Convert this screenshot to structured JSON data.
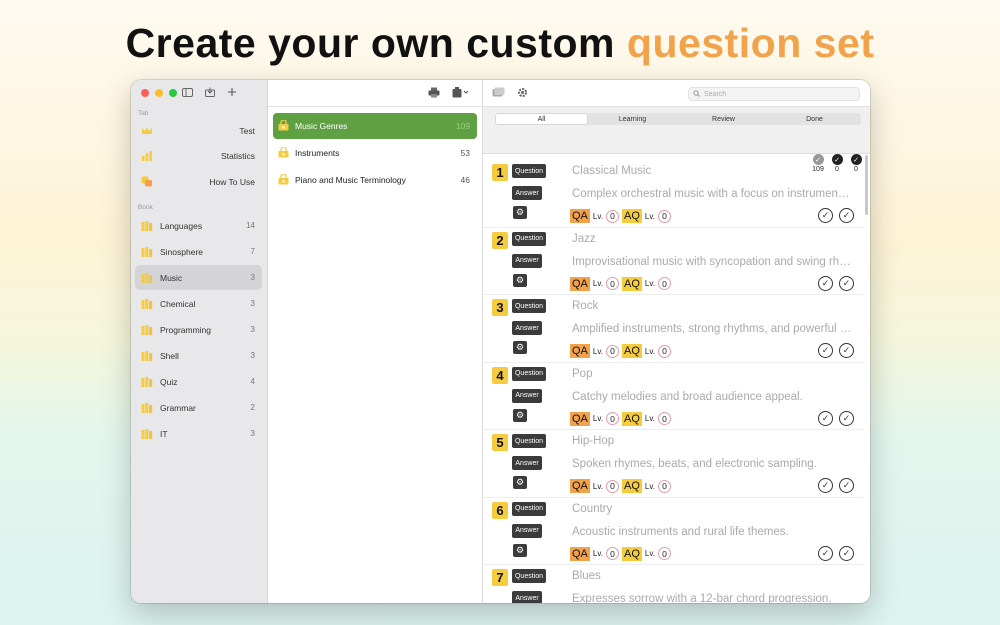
{
  "headline": {
    "main": "Create your own custom",
    "accent": "question set"
  },
  "colors": {
    "accent_orange": "#f2a24a",
    "accent_yellow": "#f5cc3e",
    "selected_green": "#5fa043"
  },
  "sidebar": {
    "tab_section": "Tab",
    "book_section": "Book",
    "tabs": [
      {
        "label": "Test",
        "icon": "crown-icon"
      },
      {
        "label": "Statistics",
        "icon": "bar-chart-icon"
      },
      {
        "label": "How To Use",
        "icon": "help-icon"
      }
    ],
    "books": [
      {
        "label": "Languages",
        "count": "14"
      },
      {
        "label": "Sinosphere",
        "count": "7"
      },
      {
        "label": "Music",
        "count": "3",
        "selected": true
      },
      {
        "label": "Chemical",
        "count": "3"
      },
      {
        "label": "Programming",
        "count": "3"
      },
      {
        "label": "Shell",
        "count": "3"
      },
      {
        "label": "Quiz",
        "count": "4"
      },
      {
        "label": "Grammar",
        "count": "2"
      },
      {
        "label": "IT",
        "count": "3"
      }
    ]
  },
  "sets": [
    {
      "label": "Music Genres",
      "count": "109",
      "selected": true
    },
    {
      "label": "Instruments",
      "count": "53"
    },
    {
      "label": "Piano and Music Terminology",
      "count": "46"
    }
  ],
  "search": {
    "placeholder": "Search"
  },
  "filters": {
    "tabs": [
      "All",
      "Learning",
      "Review",
      "Done"
    ],
    "stats": [
      "109",
      "0",
      "0"
    ]
  },
  "row_labels": {
    "question": "Question",
    "answer": "Answer",
    "qa": "QA",
    "aq": "AQ",
    "lv": "Lv.",
    "level": "0"
  },
  "cards": [
    {
      "n": "1",
      "q": "Classical Music",
      "a": "Complex orchestral music with a focus on instrumental composition."
    },
    {
      "n": "2",
      "q": "Jazz",
      "a": "Improvisational music with syncopation and swing rhythms."
    },
    {
      "n": "3",
      "q": "Rock",
      "a": "Amplified instruments, strong rhythms, and powerful vocals."
    },
    {
      "n": "4",
      "q": "Pop",
      "a": "Catchy melodies and broad audience appeal."
    },
    {
      "n": "5",
      "q": "Hip-Hop",
      "a": "Spoken rhymes, beats, and electronic sampling."
    },
    {
      "n": "6",
      "q": "Country",
      "a": "Acoustic instruments and rural life themes."
    },
    {
      "n": "7",
      "q": "Blues",
      "a": "Expresses sorrow with a 12-bar chord progression."
    }
  ]
}
